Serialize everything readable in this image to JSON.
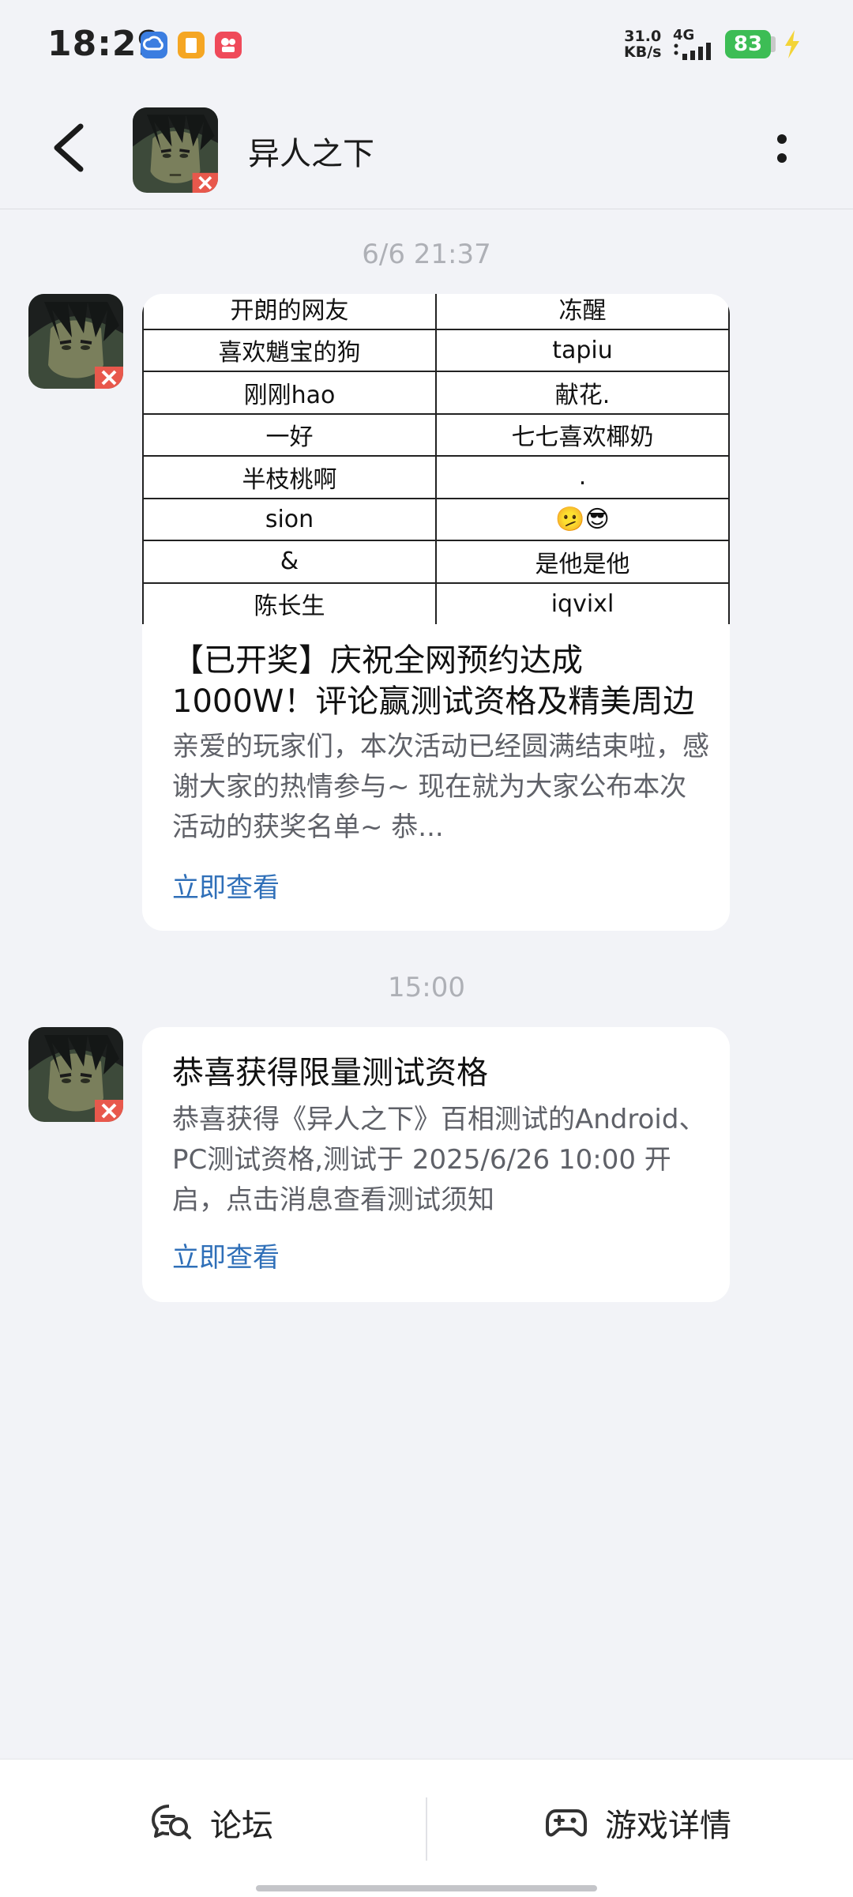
{
  "status_bar": {
    "time": "18:29",
    "net_speed_value": "31.0",
    "net_speed_unit": "KB/s",
    "network": "4G",
    "battery": "83",
    "battery_color": "#3dbd55"
  },
  "header": {
    "title": "异人之下"
  },
  "messages": [
    {
      "timestamp": "6/6  21:37",
      "table_rows": [
        [
          "开朗的网友",
          "冻醒"
        ],
        [
          "喜欢魈宝的狗",
          "tapiu"
        ],
        [
          "刚刚hao",
          "献花."
        ],
        [
          "一好",
          "七七喜欢椰奶"
        ],
        [
          "半枝桃啊",
          "."
        ],
        [
          "sion",
          "🫤😎"
        ],
        [
          "&",
          "是他是他"
        ],
        [
          "陈长生",
          "iqvixl"
        ]
      ],
      "title": "【已开奖】庆祝全网预约达成1000W！评论赢测试资格及精美周边",
      "body": "亲爱的玩家们，本次活动已经圆满结束啦，感谢大家的热情参与~ 现在就为大家公布本次活动的获奖名单~ 恭...",
      "link": "立即查看"
    },
    {
      "timestamp": "15:00",
      "title": "恭喜获得限量测试资格",
      "body": "恭喜获得《异人之下》百相测试的Android、PC测试资格,测试于 2025/6/26 10:00 开启，点击消息查看测试须知",
      "link": "立即查看"
    }
  ],
  "bottom_bar": {
    "forum_label": "论坛",
    "game_details_label": "游戏详情"
  },
  "colors": {
    "link": "#2f6fb8",
    "background": "#f2f3f7"
  }
}
